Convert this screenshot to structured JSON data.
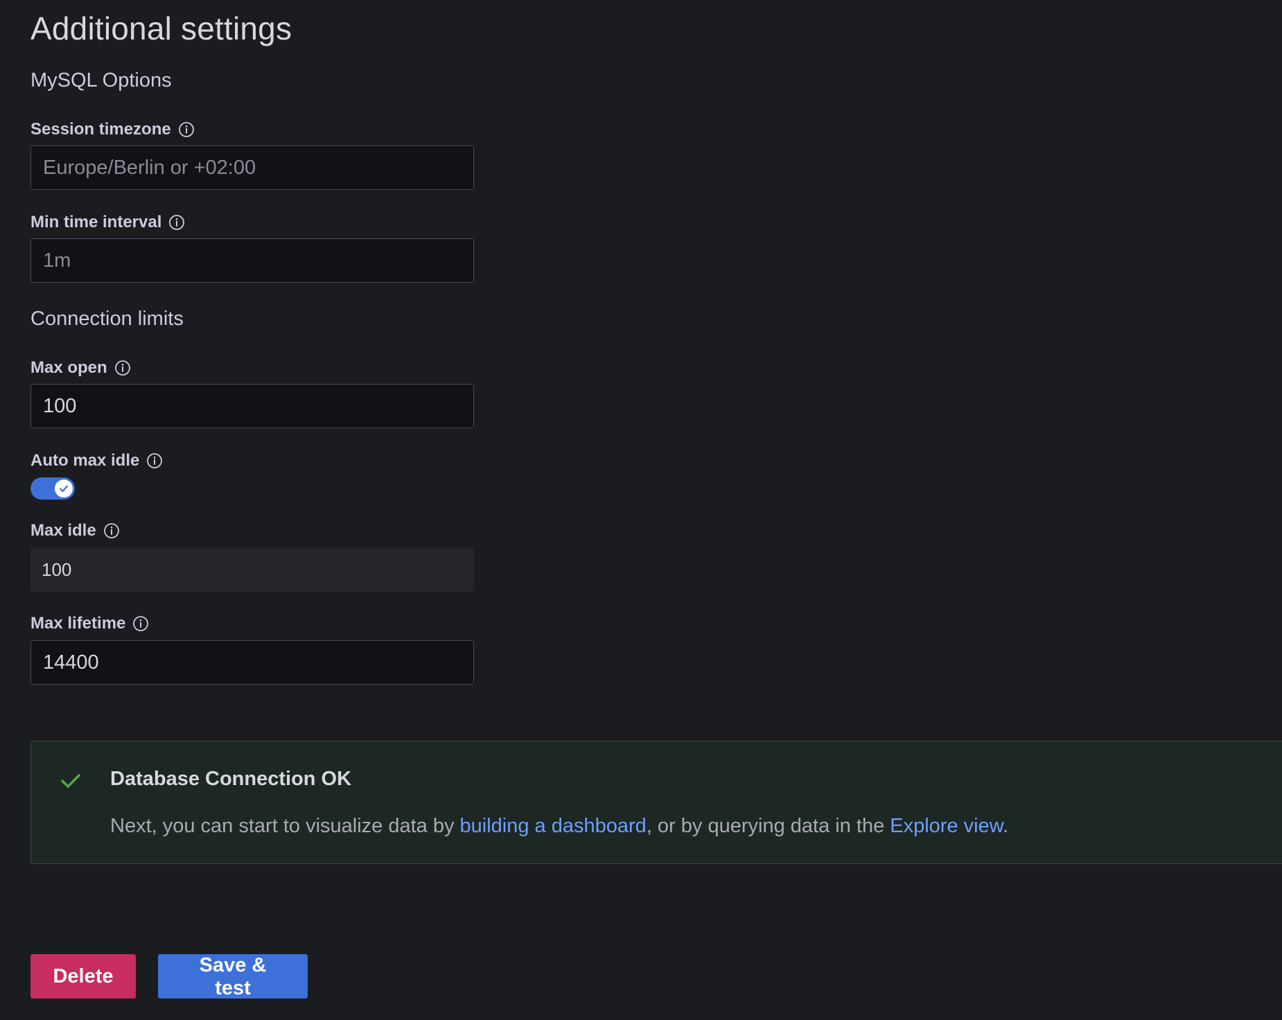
{
  "page": {
    "title": "Additional settings"
  },
  "mysql_options": {
    "title": "MySQL Options",
    "session_timezone": {
      "label": "Session timezone",
      "value": "",
      "placeholder": "Europe/Berlin or +02:00"
    },
    "min_time_interval": {
      "label": "Min time interval",
      "value": "",
      "placeholder": "1m"
    }
  },
  "connection_limits": {
    "title": "Connection limits",
    "max_open": {
      "label": "Max open",
      "value": "100"
    },
    "auto_max_idle": {
      "label": "Auto max idle",
      "checked": true
    },
    "max_idle": {
      "label": "Max idle",
      "value": "100"
    },
    "max_lifetime": {
      "label": "Max lifetime",
      "value": "14400"
    }
  },
  "alert": {
    "title": "Database Connection OK",
    "text_before": "Next, you can start to visualize data by ",
    "link1": "building a dashboard",
    "text_middle": ", or by querying data in the ",
    "link2": "Explore view",
    "text_after": ".",
    "icon": "check-icon"
  },
  "actions": {
    "delete_label": "Delete",
    "save_label": "Save & test"
  },
  "colors": {
    "background": "#1b1c20",
    "primary": "#3d71d9",
    "destructive": "#c72d5e",
    "success": "#56a64b",
    "link": "#6e9fff"
  }
}
